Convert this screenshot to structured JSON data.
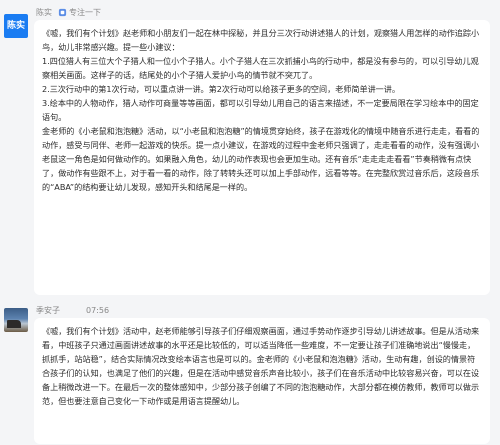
{
  "messages": [
    {
      "avatar_text": "陈实",
      "sender": "陈实",
      "tag": "专注一下",
      "paragraphs": [
        "《嘘，我们有个计划》赵老师和小朋友们一起在林中探秘，并且分三次行动讲述猎人的计划，观察猎人用怎样的动作追踪小鸟，幼儿非常感兴趣。提一些小建议：",
        "1.四位猎人有三位大个子猎人和一位小个子猎人。小个子猎人在三次抓捕小鸟的行动中，都是没有参与的，可以引导幼儿观察相关画面。这样子的话，结尾处的小个子猎人爱护小鸟的情节就不突兀了。",
        "2.三次行动中的第1次行动，可以重点讲一讲。第2次行动可以给孩子更多的空间，老师简单讲一讲。",
        "3.绘本中的人物动作，猎人动作可商量等等画面，都可以引导幼儿用自己的语言来描述，不一定要局限在学习绘本中的固定语句。",
        "金老师的《小老鼠和泡泡糖》活动，以“小老鼠和泡泡糖”的情境贯穿始终，孩子在游戏化的情境中随音乐进行走走，看看的动作，感受与同伴、老师一起游戏的快乐。提一点小建议，在游戏的过程中金老师只强调了，走走看看的动作，没有强调小老鼠这一角色是如何做动作的。如果融入角色，幼儿的动作表现也会更加生动。还有音乐“走走走走看看”节奏稍微有点快了，做动作有些跟不上，对于看一看的动作，除了转转头还可以加上手部动作，远看等等。在完整欣赏过音乐后，这段音乐的“ABA”的结构要让幼儿发现，感知开头和结尾是一样的。"
      ]
    },
    {
      "sender": "季安子",
      "time": "07:56",
      "paragraphs": [
        "《嘘，我们有个计划》活动中，赵老师能够引导孩子们仔细观察画面，通过手势动作逐步引导幼儿讲述故事。但是从活动来看，中班孩子只通过画面讲述故事的水平还是比较低的，可以适当降低一些难度，不一定要让孩子们准确地说出“慢慢走，抓抓手，站站稳”，结合实际情况改变绘本语言也是可以的。金老师的《小老鼠和泡泡糖》活动，生动有趣，创设的情景符合孩子们的认知，也满足了他们的兴趣，但是在活动中感觉音乐声音比较小，孩子们在音乐活动中比较容易兴奋，可以在设备上稍微改进一下。在最后一次的整体感知中，少部分孩子创编了不同的泡泡糖动作，大部分都在模仿教师，教师可以做示范，但也要注意自己变化一下动作或是用语言提醒幼儿。"
      ]
    }
  ]
}
